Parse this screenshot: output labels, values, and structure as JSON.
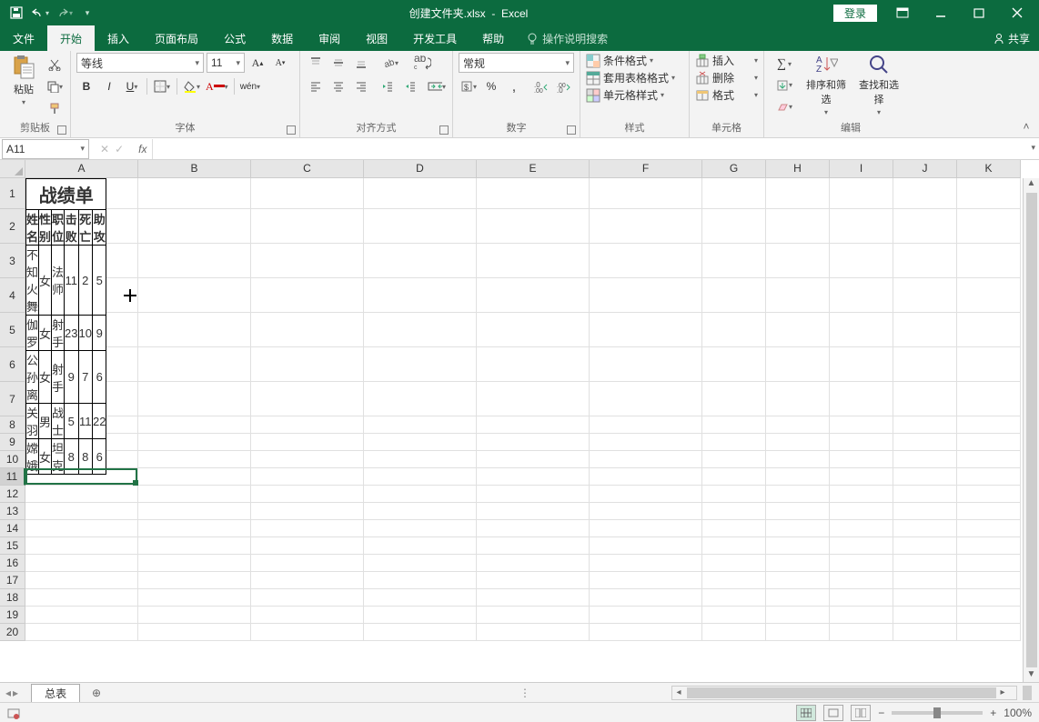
{
  "titlebar": {
    "filename": "创建文件夹.xlsx",
    "app": "Excel",
    "login": "登录"
  },
  "menu": {
    "tabs": [
      "文件",
      "开始",
      "插入",
      "页面布局",
      "公式",
      "数据",
      "审阅",
      "视图",
      "开发工具",
      "帮助"
    ],
    "active": 1,
    "tell": "操作说明搜索",
    "share": "共享"
  },
  "ribbon": {
    "clipboard": {
      "paste": "粘贴",
      "label": "剪贴板"
    },
    "font": {
      "name": "等线",
      "size": "11",
      "wen": "wén",
      "label": "字体"
    },
    "alignment": {
      "label": "对齐方式"
    },
    "number": {
      "format": "常规",
      "label": "数字"
    },
    "styles": {
      "conditional": "条件格式",
      "table_format": "套用表格格式",
      "cell_styles": "单元格样式",
      "label": "样式"
    },
    "cells": {
      "insert": "插入",
      "delete": "删除",
      "format": "格式",
      "label": "单元格"
    },
    "editing": {
      "sort_filter": "排序和筛选",
      "find_select": "查找和选择",
      "label": "编辑"
    }
  },
  "namebox": "A11",
  "fx": "fx",
  "columns": [
    "A",
    "B",
    "C",
    "D",
    "E",
    "F",
    "G",
    "H",
    "I",
    "J",
    "K"
  ],
  "rows": [
    "1",
    "2",
    "3",
    "4",
    "5",
    "6",
    "7",
    "8",
    "9",
    "10",
    "11",
    "12",
    "13",
    "14",
    "15",
    "16",
    "17",
    "18",
    "19",
    "20"
  ],
  "selected_row_idx": 10,
  "table": {
    "title": "战绩单",
    "headers": [
      "姓名",
      "性别",
      "职位",
      "击败",
      "死亡",
      "助攻"
    ],
    "rows": [
      [
        "不知火舞",
        "女",
        "法师",
        "11",
        "2",
        "5"
      ],
      [
        "伽罗",
        "女",
        "射手",
        "23",
        "10",
        "9"
      ],
      [
        "公孙离",
        "女",
        "射手",
        "9",
        "7",
        "6"
      ],
      [
        "关羽",
        "男",
        "战士",
        "5",
        "11",
        "22"
      ],
      [
        "嫦娥",
        "女",
        "坦克",
        "8",
        "8",
        "6"
      ]
    ]
  },
  "sheet_tab": "总表",
  "zoom": "100%",
  "col_widths": {
    "std": 70,
    "data": 124
  },
  "row_heights": {
    "title": 34,
    "data": 38,
    "std": 19
  }
}
